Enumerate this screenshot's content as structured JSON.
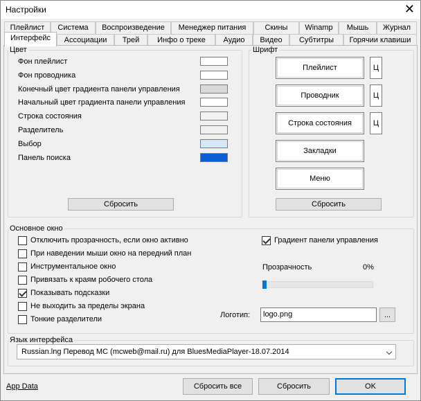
{
  "window": {
    "title": "Настройки",
    "close_glyph": "✕"
  },
  "tabs_row1": [
    "Плейлист",
    "Система",
    "Воспроизведение",
    "Менеджер питания",
    "Скины",
    "Winamp",
    "Мышь",
    "Журнал"
  ],
  "tabs_row2": [
    "Интерфейс",
    "Ассоциации",
    "Трей",
    "Инфо о треке",
    "Аудио",
    "Видео",
    "Субтитры",
    "Горячии клавиши"
  ],
  "active_tab": "Интерфейс",
  "color_group": {
    "legend": "Цвет",
    "items": [
      {
        "label": "Фон плейлист",
        "color": "#ffffff"
      },
      {
        "label": "Фон проводника",
        "color": "#ffffff"
      },
      {
        "label": "Конечный цвет градиента панели управления",
        "color": "#d9d9d9"
      },
      {
        "label": "Начальный цвет градиента панели управления",
        "color": "#ffffff"
      },
      {
        "label": "Строка состояния",
        "color": "#f2f2f2"
      },
      {
        "label": "Разделитель",
        "color": "#f0f0f0"
      },
      {
        "label": "Выбор",
        "color": "#d5e6f7"
      },
      {
        "label": "Панель поиска",
        "color": "#0a5fd4"
      }
    ],
    "reset_label": "Сбросить"
  },
  "font_group": {
    "legend": "Шрифт",
    "buttons": [
      {
        "label": "Плейлист",
        "c": "Ц"
      },
      {
        "label": "Проводник",
        "c": "Ц"
      },
      {
        "label": "Строка состояния",
        "c": "Ц"
      },
      {
        "label": "Закладки",
        "c": ""
      },
      {
        "label": "Меню",
        "c": ""
      }
    ],
    "reset_label": "Сбросить"
  },
  "main_window": {
    "legend": "Основное окно",
    "checkboxes": [
      {
        "label": "Отключить прозрачность, если окно активно",
        "checked": false
      },
      {
        "label": "При наведении мыши окно на передний план",
        "checked": false
      },
      {
        "label": "Инструментальное окно",
        "checked": false
      },
      {
        "label": "Привязать к краям робочего стола",
        "checked": false
      },
      {
        "label": "Показывать подсказки",
        "checked": true
      },
      {
        "label": "Не выходить за пределы экрана",
        "checked": false
      },
      {
        "label": "Тонкие разделители",
        "checked": false
      }
    ],
    "gradient": {
      "label": "Градиент панели управления",
      "checked": true
    },
    "transparency": {
      "label": "Прозрачность",
      "value_text": "0%",
      "value": 0
    },
    "logo": {
      "label": "Логотип:",
      "value": "logo.png",
      "browse_label": "..."
    }
  },
  "language": {
    "legend": "Язык интерфейса",
    "selected": "Russian.lng Перевод MC (mcweb@mail.ru) для BluesMediaPlayer-18.07.2014"
  },
  "footer": {
    "app_data_link": "App Data",
    "reset_all": "Сбросить все",
    "reset": "Сбросить",
    "ok": "OK"
  },
  "colors": {
    "accent": "#0078d7",
    "search_panel": "#0a5fd4",
    "ok_border": "#0078d7"
  }
}
